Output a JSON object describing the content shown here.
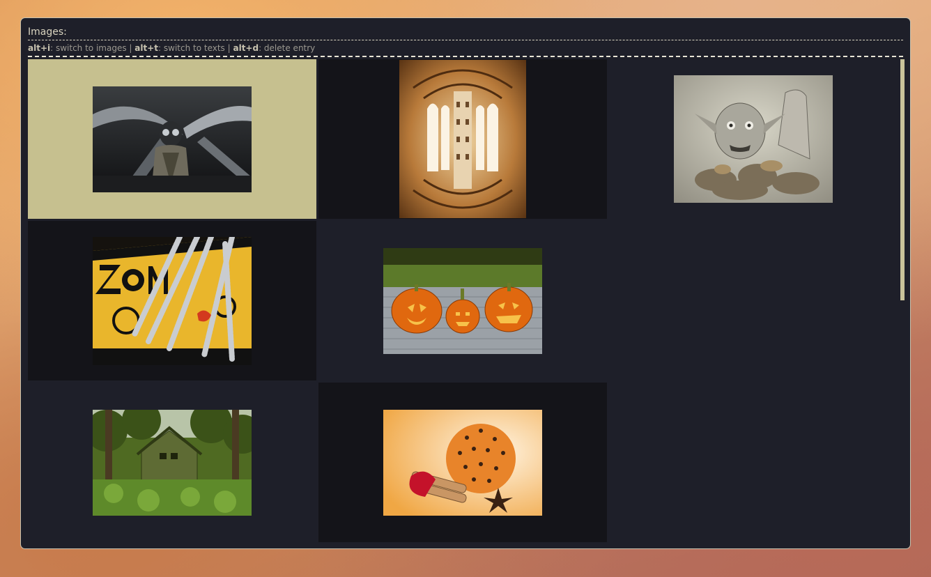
{
  "panel": {
    "title": "Images:",
    "help": [
      {
        "key": "alt+i",
        "desc": ": switch to images"
      },
      {
        "key": "alt+t",
        "desc": ": switch to texts"
      },
      {
        "key": "alt+d",
        "desc": ": delete entry"
      }
    ],
    "separator": " | "
  },
  "thumbnails": [
    {
      "name": "gas-mask-pilot",
      "selected": true
    },
    {
      "name": "arched-colonnade",
      "selected": false
    },
    {
      "name": "stone-troll-sculpture",
      "selected": false
    },
    {
      "name": "zombie-warning-sign",
      "selected": false
    },
    {
      "name": "carved-pumpkins",
      "selected": false
    },
    {
      "name": "overgrown-house",
      "selected": false
    },
    {
      "name": "clove-orange",
      "selected": false
    }
  ],
  "colors": {
    "panel_bg": "#1e1f29",
    "cell_dark": "#141419",
    "selection": "#c6c08f",
    "text": "#d9d4c0"
  }
}
